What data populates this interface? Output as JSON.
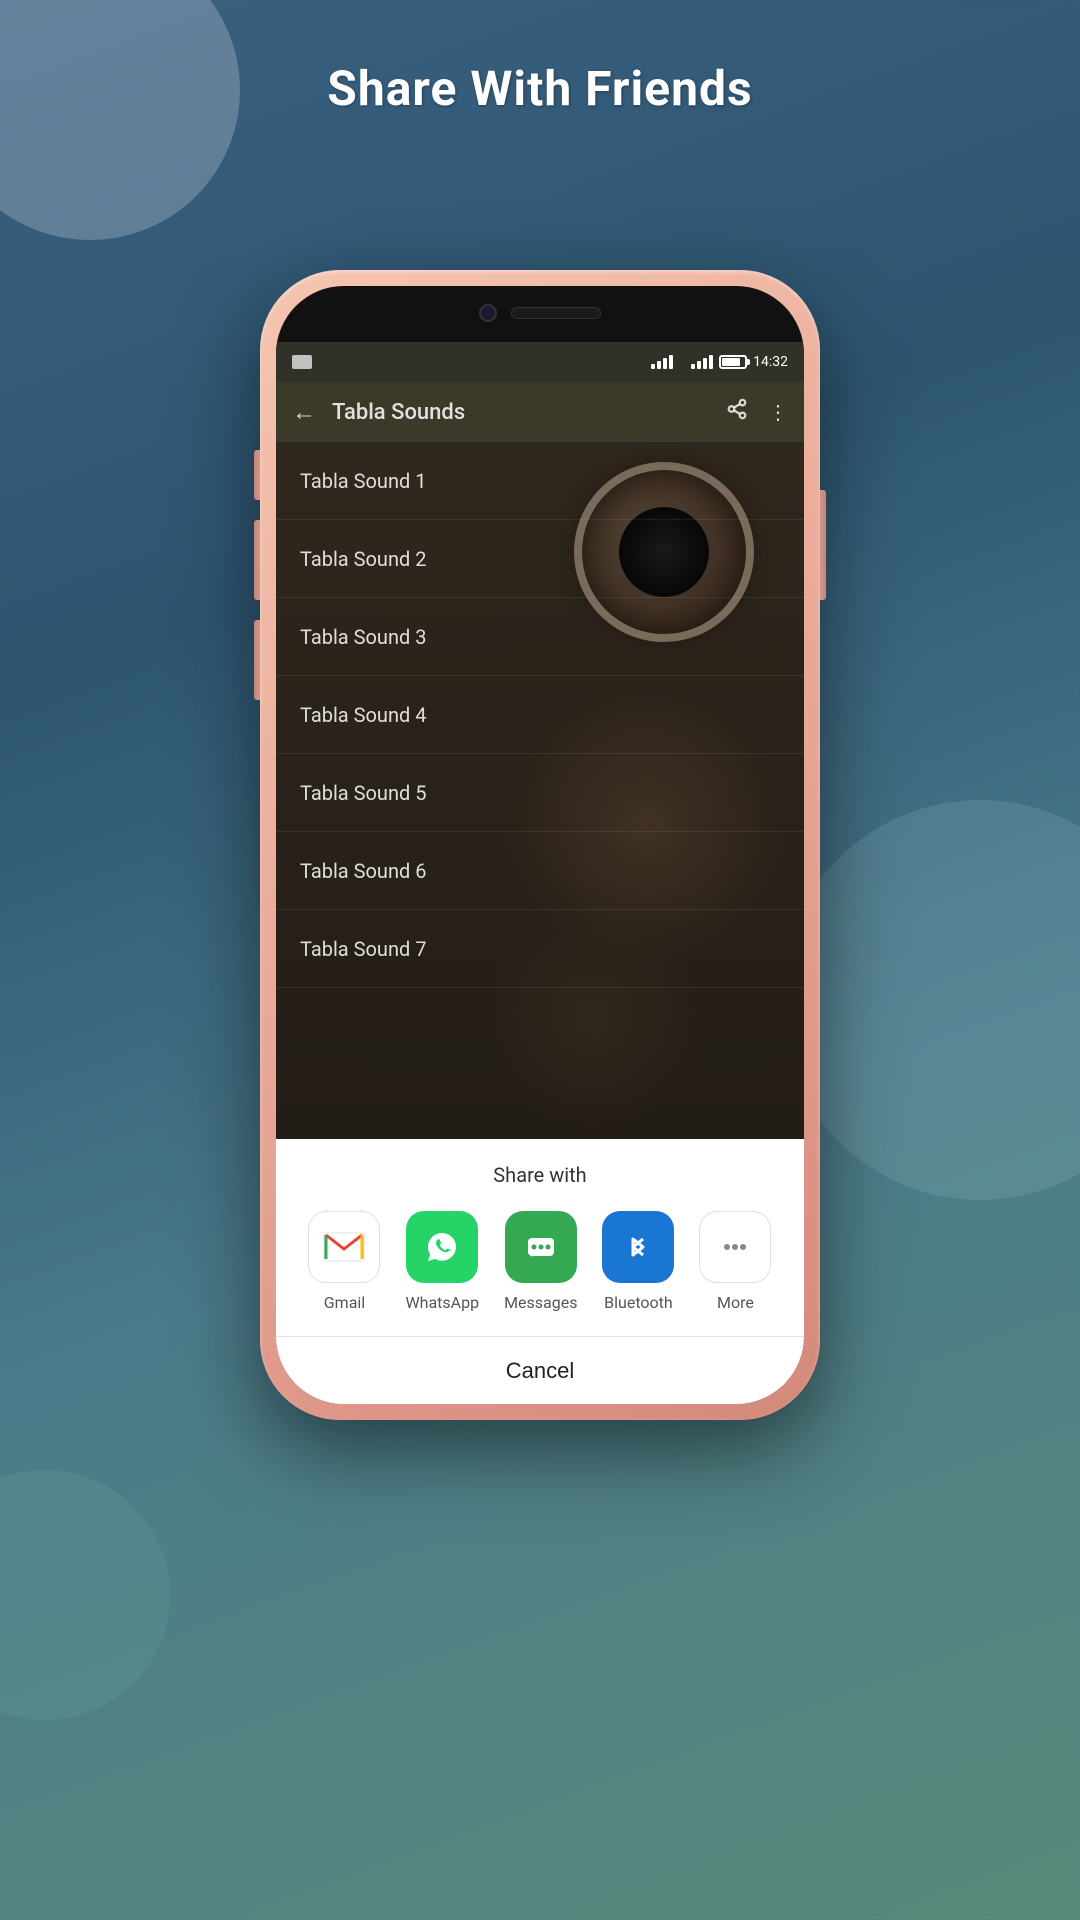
{
  "page": {
    "title": "Share With Friends",
    "background_gradient_start": "#3a6080",
    "background_gradient_end": "#4a7a8a"
  },
  "status_bar": {
    "time": "14:32",
    "battery_percent": 80
  },
  "app_bar": {
    "title": "Tabla Sounds",
    "back_label": "←",
    "share_icon": "⋮",
    "menu_icon": "⋮"
  },
  "sound_list": {
    "items": [
      {
        "id": 1,
        "label": "Tabla Sound 1"
      },
      {
        "id": 2,
        "label": "Tabla Sound 2"
      },
      {
        "id": 3,
        "label": "Tabla Sound 3"
      },
      {
        "id": 4,
        "label": "Tabla Sound 4"
      },
      {
        "id": 5,
        "label": "Tabla Sound 5"
      },
      {
        "id": 6,
        "label": "Tabla Sound 6"
      },
      {
        "id": 7,
        "label": "Tabla Sound 7"
      }
    ]
  },
  "share_sheet": {
    "title": "Share with",
    "apps": [
      {
        "id": "gmail",
        "label": "Gmail",
        "color": "#ffffff",
        "icon_type": "gmail"
      },
      {
        "id": "whatsapp",
        "label": "WhatsApp",
        "color": "#25d366",
        "icon_type": "whatsapp"
      },
      {
        "id": "messages",
        "label": "Messages",
        "color": "#34a853",
        "icon_type": "messages"
      },
      {
        "id": "bluetooth",
        "label": "Bluetooth",
        "color": "#1976d2",
        "icon_type": "bluetooth"
      },
      {
        "id": "more",
        "label": "More",
        "color": "#ffffff",
        "icon_type": "more"
      }
    ],
    "cancel_label": "Cancel"
  }
}
